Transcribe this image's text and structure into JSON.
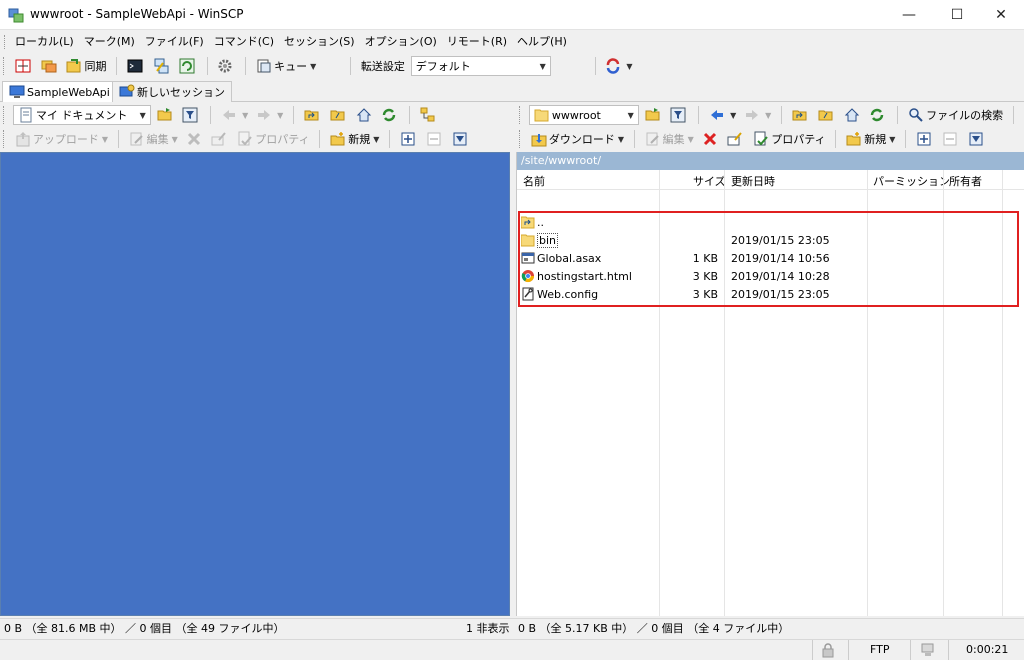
{
  "window": {
    "title": "wwwroot - SampleWebApi - WinSCP"
  },
  "menu": [
    "ローカル(L)",
    "マーク(M)",
    "ファイル(F)",
    "コマンド(C)",
    "セッション(S)",
    "オプション(O)",
    "リモート(R)",
    "ヘルプ(H)"
  ],
  "toolbar": {
    "sync_label": "同期",
    "queue_label": "キュー",
    "transfer_label": "転送設定",
    "transfer_value": "デフォルト"
  },
  "tabs": {
    "active": "SampleWebApi",
    "new_session": "新しいセッション"
  },
  "local": {
    "location": "マイ ドキュメント",
    "upload_label": "アップロード",
    "edit_label": "編集",
    "properties_label": "プロパティ",
    "new_label": "新規",
    "status": "0 B （全 81.6 MB 中） ／ 0 個目 （全 49 ファイル中）",
    "hidden": "1 非表示"
  },
  "remote": {
    "location": "wwwroot",
    "find_label": "ファイルの検索",
    "download_label": "ダウンロード",
    "edit_label": "編集",
    "properties_label": "プロパティ",
    "new_label": "新規",
    "path": "/site/wwwroot/",
    "columns": {
      "name": "名前",
      "size": "サイズ",
      "modified": "更新日時",
      "permissions": "パーミッション",
      "owner": "所有者"
    },
    "files": [
      {
        "name": "..",
        "size": "",
        "modified": "",
        "icon": "parent-folder-icon"
      },
      {
        "name": "bin",
        "size": "",
        "modified": "2019/01/15 23:05",
        "icon": "folder-icon"
      },
      {
        "name": "Global.asax",
        "size": "1 KB",
        "modified": "2019/01/14 10:56",
        "icon": "asax-file-icon"
      },
      {
        "name": "hostingstart.html",
        "size": "3 KB",
        "modified": "2019/01/14 10:28",
        "icon": "chrome-html-icon"
      },
      {
        "name": "Web.config",
        "size": "3 KB",
        "modified": "2019/01/15 23:05",
        "icon": "config-file-icon"
      }
    ],
    "status": "0 B （全 5.17 KB 中） ／ 0 個目 （全 4 ファイル中）"
  },
  "statusbar": {
    "protocol": "FTP",
    "elapsed": "0:00:21"
  },
  "colors": {
    "local_panel": "#4472c4",
    "path_bar": "#9bb7d4",
    "highlight": "#e02020"
  }
}
